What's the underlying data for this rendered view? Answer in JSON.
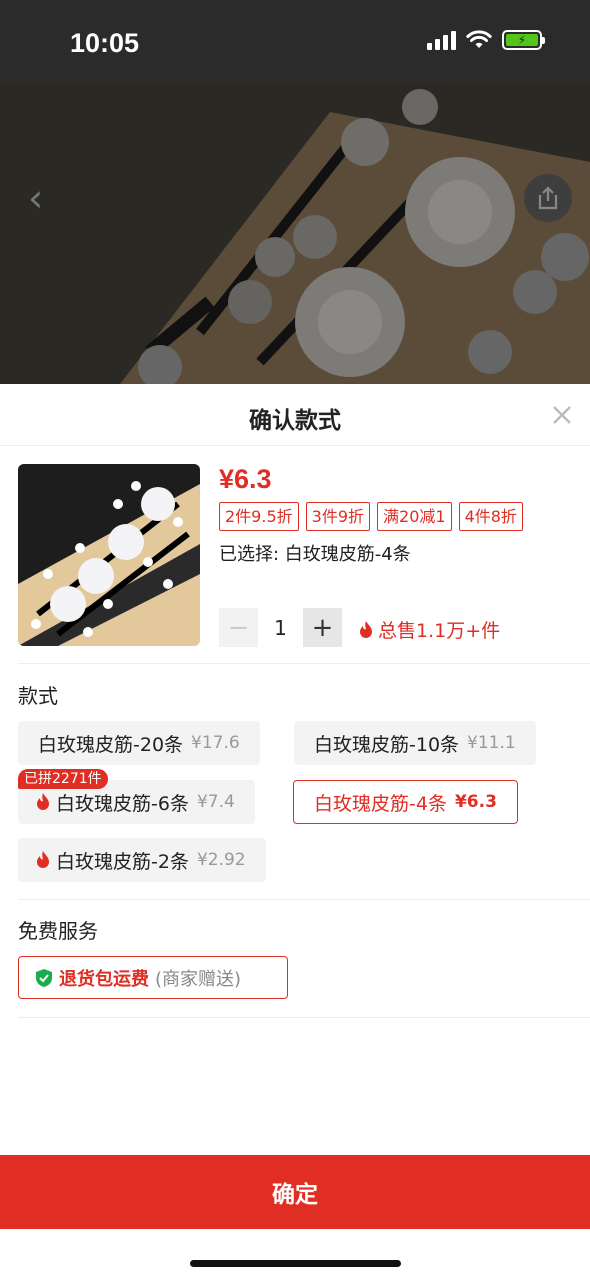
{
  "status_bar": {
    "time": "10:05"
  },
  "sheet": {
    "title": "确认款式",
    "product": {
      "price": "¥6.3",
      "promo_tags": [
        "2件9.5折",
        "3件9折",
        "满20减1",
        "4件8折"
      ],
      "selected": "已选择: 白玫瑰皮筋-4条",
      "quantity": "1",
      "sales": "总售1.1万+件"
    },
    "style_section": {
      "title": "款式",
      "options": [
        {
          "label": "白玫瑰皮筋-20条",
          "price": "¥17.6",
          "hot": false,
          "selected": false
        },
        {
          "label": "白玫瑰皮筋-10条",
          "price": "¥11.1",
          "hot": false,
          "selected": false
        },
        {
          "label": "白玫瑰皮筋-6条",
          "price": "¥7.4",
          "hot": true,
          "selected": false,
          "badge": "已拼2271件"
        },
        {
          "label": "白玫瑰皮筋-4条",
          "price": "¥6.3",
          "hot": false,
          "selected": true
        },
        {
          "label": "白玫瑰皮筋-2条",
          "price": "¥2.92",
          "hot": true,
          "selected": false
        }
      ]
    },
    "service_section": {
      "title": "免费服务",
      "service_main": "退货包运费",
      "service_note": "(商家赠送)"
    },
    "confirm_label": "确定"
  },
  "colors": {
    "accent": "#e02e24",
    "battery": "#52c41a"
  }
}
